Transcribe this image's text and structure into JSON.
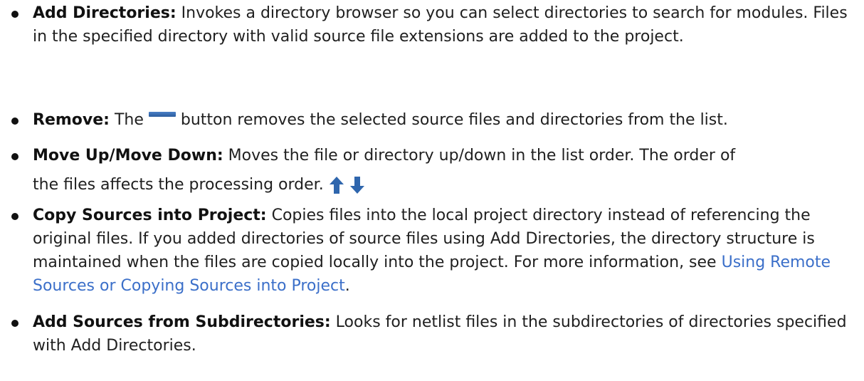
{
  "items": [
    {
      "term": "Add Directories:",
      "text": " Invokes a directory browser so you can select directories to search for modules. Files in the specified directory with valid source file extensions are added to the project."
    },
    {
      "term": "Remove:",
      "text_before": " The ",
      "icon": "minus-bar-icon",
      "text_after": " button removes the selected source files and directories from the list."
    },
    {
      "term": "Move Up/Move Down:",
      "text_line1": " Moves the file or directory up/down in the list order. The order of",
      "text_line2": "the files affects the processing order.",
      "icons": [
        "arrow-up-icon",
        "arrow-down-icon"
      ]
    },
    {
      "term": "Copy Sources into Project:",
      "text": " Copies files into the local project directory instead of referencing the original files. If you added directories of source files using Add Directories, the directory structure is maintained when the files are copied locally into the project. For more information, see ",
      "link": "Using Remote Sources or Copying Sources into Project",
      "text_end": "."
    },
    {
      "term": "Add Sources from Subdirectories:",
      "text": " Looks for netlist files in the subdirectories of directories specified with Add Directories."
    }
  ],
  "colors": {
    "link": "#3b6fc9",
    "icon": "#2f66ad"
  }
}
